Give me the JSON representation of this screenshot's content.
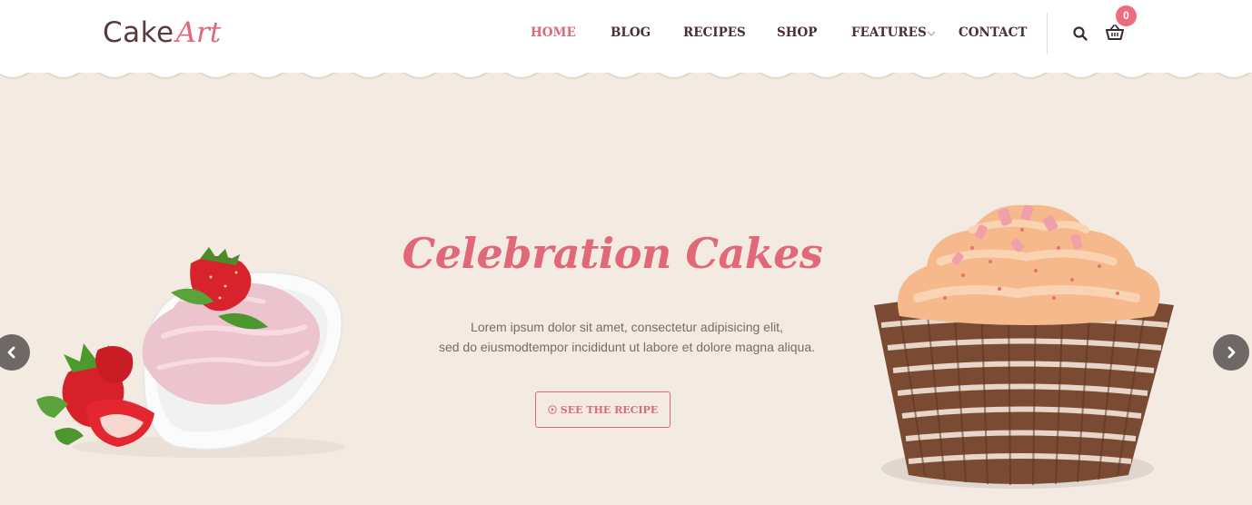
{
  "logo": {
    "main": "Cake",
    "script": "Art"
  },
  "nav": {
    "items": [
      {
        "label": "HOME",
        "active": true
      },
      {
        "label": "BLOG",
        "active": false
      },
      {
        "label": "RECIPES",
        "active": false
      },
      {
        "label": "SHOP",
        "active": false
      },
      {
        "label": "FEATURES",
        "active": false,
        "has_dropdown": true
      },
      {
        "label": "CONTACT",
        "active": false
      }
    ]
  },
  "cart": {
    "count": "0"
  },
  "hero": {
    "title": "Celebration Cakes",
    "text_line1": "Lorem ipsum dolor sit amet, consectetur adipisicing elit,",
    "text_line2": "sed do eiusmodtempor incididunt ut labore et dolore magna aliqua.",
    "cta_label": "SEE THE RECIPE"
  },
  "colors": {
    "accent": "#e06878",
    "background": "#f3ebe2",
    "nav_text": "#4a2f34",
    "arrow_bg": "#6e6866"
  },
  "icons": [
    "search-icon",
    "cart-icon",
    "chevron-down-icon",
    "play-circle-icon",
    "arrow-left-icon",
    "arrow-right-icon"
  ]
}
